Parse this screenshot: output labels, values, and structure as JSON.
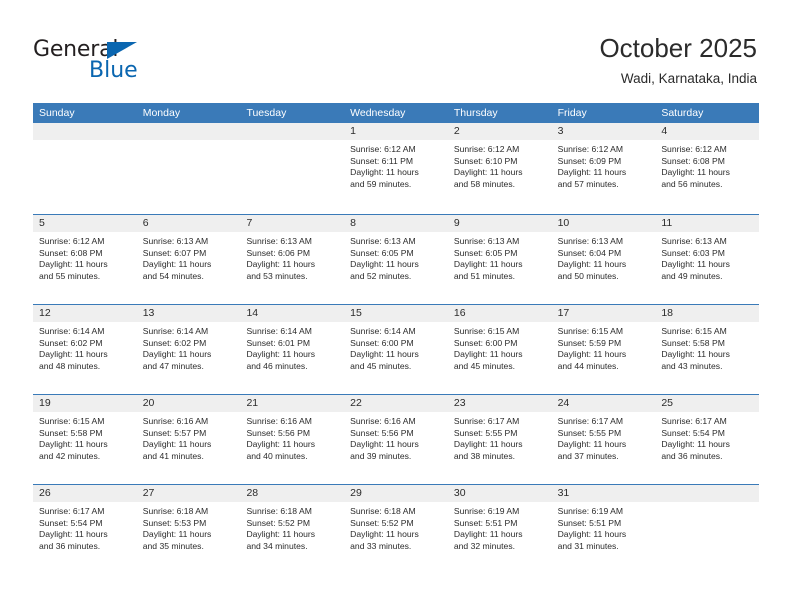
{
  "brand": {
    "name_part1": "General",
    "name_part2": "Blue",
    "triangle_icon": "blue-triangle-icon",
    "accent_color": "#0a66b0"
  },
  "header": {
    "title": "October 2025",
    "subtitle": "Wadi, Karnataka, India"
  },
  "calendar": {
    "header_bg": "#3a7ab8",
    "day_band_bg": "#efefef",
    "weekdays": [
      "Sunday",
      "Monday",
      "Tuesday",
      "Wednesday",
      "Thursday",
      "Friday",
      "Saturday"
    ],
    "weeks": [
      [
        {
          "day": "",
          "sunrise": "",
          "sunset": "",
          "daylight_line1": "",
          "daylight_line2": "",
          "empty": true
        },
        {
          "day": "",
          "sunrise": "",
          "sunset": "",
          "daylight_line1": "",
          "daylight_line2": "",
          "empty": true
        },
        {
          "day": "",
          "sunrise": "",
          "sunset": "",
          "daylight_line1": "",
          "daylight_line2": "",
          "empty": true
        },
        {
          "day": "1",
          "sunrise": "Sunrise: 6:12 AM",
          "sunset": "Sunset: 6:11 PM",
          "daylight_line1": "Daylight: 11 hours",
          "daylight_line2": "and 59 minutes."
        },
        {
          "day": "2",
          "sunrise": "Sunrise: 6:12 AM",
          "sunset": "Sunset: 6:10 PM",
          "daylight_line1": "Daylight: 11 hours",
          "daylight_line2": "and 58 minutes."
        },
        {
          "day": "3",
          "sunrise": "Sunrise: 6:12 AM",
          "sunset": "Sunset: 6:09 PM",
          "daylight_line1": "Daylight: 11 hours",
          "daylight_line2": "and 57 minutes."
        },
        {
          "day": "4",
          "sunrise": "Sunrise: 6:12 AM",
          "sunset": "Sunset: 6:08 PM",
          "daylight_line1": "Daylight: 11 hours",
          "daylight_line2": "and 56 minutes."
        }
      ],
      [
        {
          "day": "5",
          "sunrise": "Sunrise: 6:12 AM",
          "sunset": "Sunset: 6:08 PM",
          "daylight_line1": "Daylight: 11 hours",
          "daylight_line2": "and 55 minutes."
        },
        {
          "day": "6",
          "sunrise": "Sunrise: 6:13 AM",
          "sunset": "Sunset: 6:07 PM",
          "daylight_line1": "Daylight: 11 hours",
          "daylight_line2": "and 54 minutes."
        },
        {
          "day": "7",
          "sunrise": "Sunrise: 6:13 AM",
          "sunset": "Sunset: 6:06 PM",
          "daylight_line1": "Daylight: 11 hours",
          "daylight_line2": "and 53 minutes."
        },
        {
          "day": "8",
          "sunrise": "Sunrise: 6:13 AM",
          "sunset": "Sunset: 6:05 PM",
          "daylight_line1": "Daylight: 11 hours",
          "daylight_line2": "and 52 minutes."
        },
        {
          "day": "9",
          "sunrise": "Sunrise: 6:13 AM",
          "sunset": "Sunset: 6:05 PM",
          "daylight_line1": "Daylight: 11 hours",
          "daylight_line2": "and 51 minutes."
        },
        {
          "day": "10",
          "sunrise": "Sunrise: 6:13 AM",
          "sunset": "Sunset: 6:04 PM",
          "daylight_line1": "Daylight: 11 hours",
          "daylight_line2": "and 50 minutes."
        },
        {
          "day": "11",
          "sunrise": "Sunrise: 6:13 AM",
          "sunset": "Sunset: 6:03 PM",
          "daylight_line1": "Daylight: 11 hours",
          "daylight_line2": "and 49 minutes."
        }
      ],
      [
        {
          "day": "12",
          "sunrise": "Sunrise: 6:14 AM",
          "sunset": "Sunset: 6:02 PM",
          "daylight_line1": "Daylight: 11 hours",
          "daylight_line2": "and 48 minutes."
        },
        {
          "day": "13",
          "sunrise": "Sunrise: 6:14 AM",
          "sunset": "Sunset: 6:02 PM",
          "daylight_line1": "Daylight: 11 hours",
          "daylight_line2": "and 47 minutes."
        },
        {
          "day": "14",
          "sunrise": "Sunrise: 6:14 AM",
          "sunset": "Sunset: 6:01 PM",
          "daylight_line1": "Daylight: 11 hours",
          "daylight_line2": "and 46 minutes."
        },
        {
          "day": "15",
          "sunrise": "Sunrise: 6:14 AM",
          "sunset": "Sunset: 6:00 PM",
          "daylight_line1": "Daylight: 11 hours",
          "daylight_line2": "and 45 minutes."
        },
        {
          "day": "16",
          "sunrise": "Sunrise: 6:15 AM",
          "sunset": "Sunset: 6:00 PM",
          "daylight_line1": "Daylight: 11 hours",
          "daylight_line2": "and 45 minutes."
        },
        {
          "day": "17",
          "sunrise": "Sunrise: 6:15 AM",
          "sunset": "Sunset: 5:59 PM",
          "daylight_line1": "Daylight: 11 hours",
          "daylight_line2": "and 44 minutes."
        },
        {
          "day": "18",
          "sunrise": "Sunrise: 6:15 AM",
          "sunset": "Sunset: 5:58 PM",
          "daylight_line1": "Daylight: 11 hours",
          "daylight_line2": "and 43 minutes."
        }
      ],
      [
        {
          "day": "19",
          "sunrise": "Sunrise: 6:15 AM",
          "sunset": "Sunset: 5:58 PM",
          "daylight_line1": "Daylight: 11 hours",
          "daylight_line2": "and 42 minutes."
        },
        {
          "day": "20",
          "sunrise": "Sunrise: 6:16 AM",
          "sunset": "Sunset: 5:57 PM",
          "daylight_line1": "Daylight: 11 hours",
          "daylight_line2": "and 41 minutes."
        },
        {
          "day": "21",
          "sunrise": "Sunrise: 6:16 AM",
          "sunset": "Sunset: 5:56 PM",
          "daylight_line1": "Daylight: 11 hours",
          "daylight_line2": "and 40 minutes."
        },
        {
          "day": "22",
          "sunrise": "Sunrise: 6:16 AM",
          "sunset": "Sunset: 5:56 PM",
          "daylight_line1": "Daylight: 11 hours",
          "daylight_line2": "and 39 minutes."
        },
        {
          "day": "23",
          "sunrise": "Sunrise: 6:17 AM",
          "sunset": "Sunset: 5:55 PM",
          "daylight_line1": "Daylight: 11 hours",
          "daylight_line2": "and 38 minutes."
        },
        {
          "day": "24",
          "sunrise": "Sunrise: 6:17 AM",
          "sunset": "Sunset: 5:55 PM",
          "daylight_line1": "Daylight: 11 hours",
          "daylight_line2": "and 37 minutes."
        },
        {
          "day": "25",
          "sunrise": "Sunrise: 6:17 AM",
          "sunset": "Sunset: 5:54 PM",
          "daylight_line1": "Daylight: 11 hours",
          "daylight_line2": "and 36 minutes."
        }
      ],
      [
        {
          "day": "26",
          "sunrise": "Sunrise: 6:17 AM",
          "sunset": "Sunset: 5:54 PM",
          "daylight_line1": "Daylight: 11 hours",
          "daylight_line2": "and 36 minutes."
        },
        {
          "day": "27",
          "sunrise": "Sunrise: 6:18 AM",
          "sunset": "Sunset: 5:53 PM",
          "daylight_line1": "Daylight: 11 hours",
          "daylight_line2": "and 35 minutes."
        },
        {
          "day": "28",
          "sunrise": "Sunrise: 6:18 AM",
          "sunset": "Sunset: 5:52 PM",
          "daylight_line1": "Daylight: 11 hours",
          "daylight_line2": "and 34 minutes."
        },
        {
          "day": "29",
          "sunrise": "Sunrise: 6:18 AM",
          "sunset": "Sunset: 5:52 PM",
          "daylight_line1": "Daylight: 11 hours",
          "daylight_line2": "and 33 minutes."
        },
        {
          "day": "30",
          "sunrise": "Sunrise: 6:19 AM",
          "sunset": "Sunset: 5:51 PM",
          "daylight_line1": "Daylight: 11 hours",
          "daylight_line2": "and 32 minutes."
        },
        {
          "day": "31",
          "sunrise": "Sunrise: 6:19 AM",
          "sunset": "Sunset: 5:51 PM",
          "daylight_line1": "Daylight: 11 hours",
          "daylight_line2": "and 31 minutes."
        },
        {
          "day": "",
          "sunrise": "",
          "sunset": "",
          "daylight_line1": "",
          "daylight_line2": "",
          "empty": true
        }
      ]
    ]
  }
}
